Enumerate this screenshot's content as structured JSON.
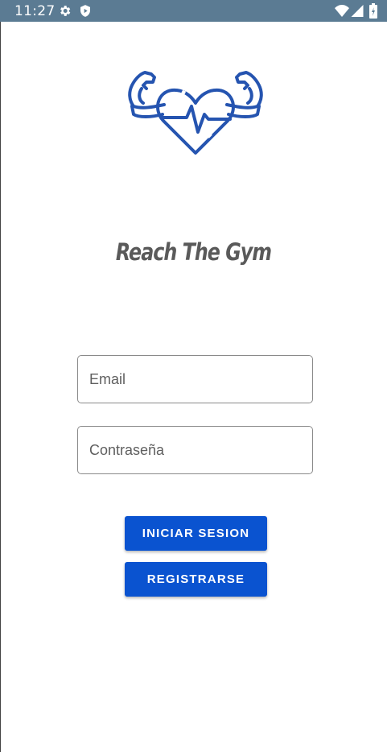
{
  "status_bar": {
    "time": "11:27",
    "icons": [
      "settings-icon",
      "play-protect-icon",
      "wifi-icon",
      "cell-signal-icon",
      "battery-icon"
    ],
    "background": "#5b7b93"
  },
  "brand": {
    "logo_icon": "heart-muscle-arms-icon",
    "title": "Reach The Gym",
    "logo_color": "#2554b0"
  },
  "form": {
    "email_placeholder": "Email",
    "password_placeholder": "Contraseña"
  },
  "buttons": {
    "login_label": "INICIAR SESION",
    "register_label": "REGISTRARSE",
    "color": "#0a53d0"
  }
}
